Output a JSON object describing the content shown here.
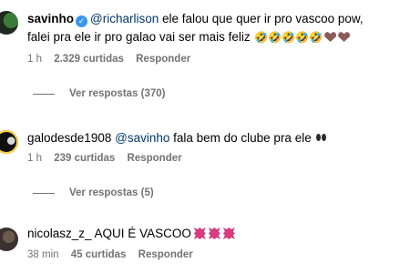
{
  "comments": [
    {
      "username": "savinho",
      "verified": true,
      "mention": "@richarlison",
      "text_line1": " ele falou que quer ir pro vascoo pow,",
      "text_line2": "falei pra ele ir pro galao vai ser mais feliz",
      "emojis": [
        "rolling-laughing-emoji",
        "heart-hands-emoji"
      ],
      "time": "1 h",
      "likes": "2.329 curtidas",
      "reply_label": "Responder",
      "view_replies": "Ver respostas (370)"
    },
    {
      "username": "galodesde1908",
      "mention": "@savinho",
      "text": " fala bem do clube pra ele ",
      "emojis": [
        "eyes-emoji"
      ],
      "time": "1 h",
      "likes": "239 curtidas",
      "reply_label": "Responder",
      "view_replies": "Ver respostas (5)"
    },
    {
      "username": "nicolasz_z_",
      "text": " AQUI É VASCOO",
      "emojis": [
        "anger-symbol-emoji"
      ],
      "time": "38 min",
      "likes": "45 curtidas",
      "reply_label": "Responder"
    }
  ]
}
